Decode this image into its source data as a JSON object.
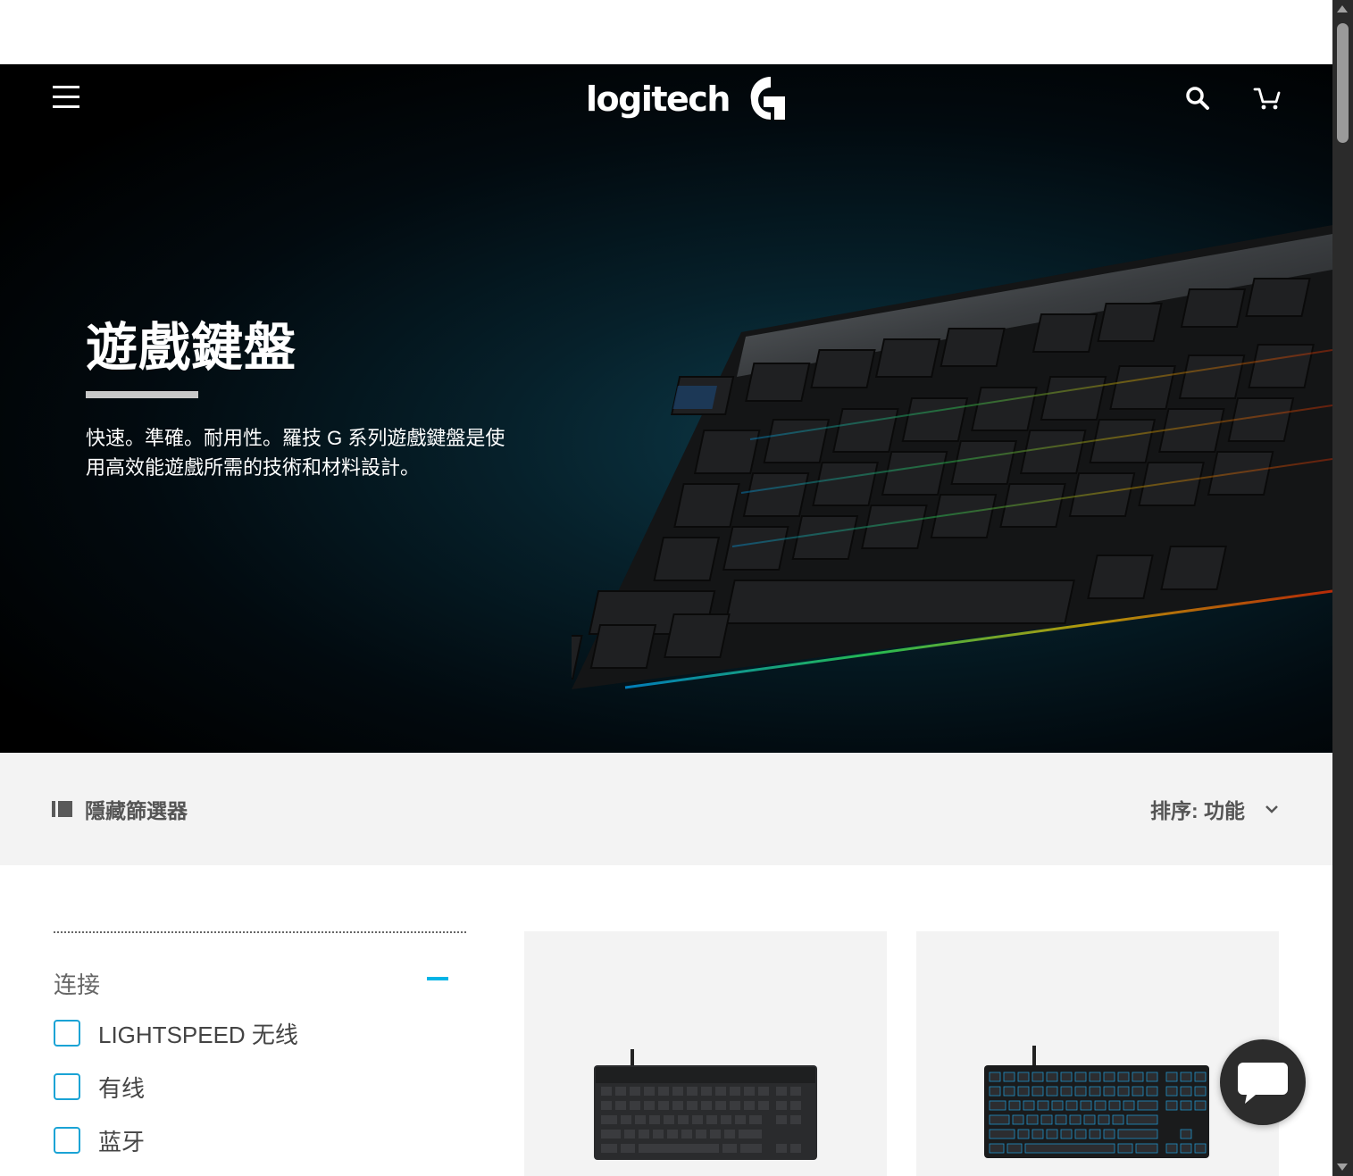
{
  "header": {
    "logo_text": "logitech",
    "menu_icon": "hamburger-menu-icon",
    "search_icon": "search-icon",
    "cart_icon": "cart-icon"
  },
  "hero": {
    "title": "遊戲鍵盤",
    "description": "快速。準確。耐用性。羅技 G 系列遊戲鍵盤是使用高效能遊戲所需的技術和材料設計。",
    "accent_color": "#c8c8c8"
  },
  "filter_bar": {
    "hide_filter_label": "隱藏篩選器",
    "sort_label": "排序: 功能",
    "sort_icon": "chevron-down-icon"
  },
  "filters": {
    "group_title": "连接",
    "options": [
      {
        "label": "LIGHTSPEED 无线",
        "checked": false
      },
      {
        "label": "有线",
        "checked": false
      },
      {
        "label": "蓝牙",
        "checked": false
      }
    ],
    "accent_color": "#00b4e6"
  },
  "chat": {
    "icon": "chat-bubble-icon"
  }
}
